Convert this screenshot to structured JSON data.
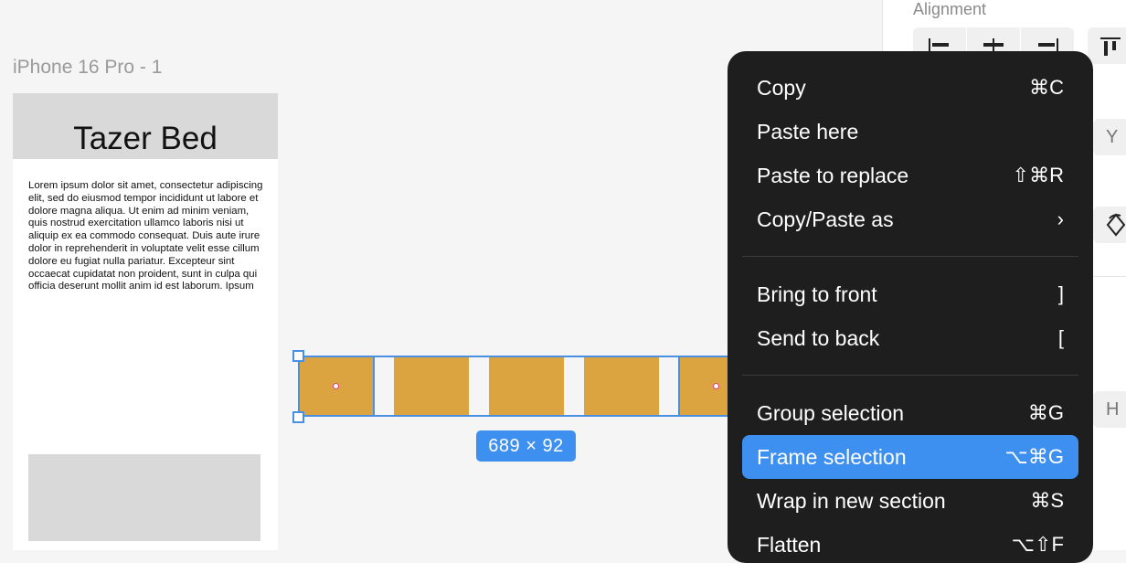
{
  "canvas": {
    "frame_label": "iPhone 16 Pro - 1",
    "frame_title": "Tazer Bed",
    "frame_body": "Lorem ipsum dolor sit amet, consectetur adipiscing elit, sed do eiusmod tempor incididunt ut labore et dolore magna aliqua. Ut enim ad minim veniam, quis nostrud exercitation ullamco laboris nisi ut aliquip ex ea commodo consequat. Duis aute irure dolor in reprehenderit in voluptate velit esse cillum dolore eu fugiat nulla pariatur. Excepteur sint occaecat cupidatat non proident, sunt in culpa qui officia deserunt mollit anim id est laborum. Ipsum",
    "selection_size": "689 × 92",
    "rect_color": "#dba440",
    "selection_color": "#4a90e2"
  },
  "panel": {
    "section_title": "Alignment",
    "field_y": "Y",
    "field_h": "H"
  },
  "menu": {
    "items": [
      {
        "label": "Copy",
        "shortcut": "⌘C"
      },
      {
        "label": "Paste here",
        "shortcut": ""
      },
      {
        "label": "Paste to replace",
        "shortcut": "⇧⌘R"
      },
      {
        "label": "Copy/Paste as",
        "shortcut": "›"
      },
      {
        "label": "Bring to front",
        "shortcut": "]"
      },
      {
        "label": "Send to back",
        "shortcut": "["
      },
      {
        "label": "Group selection",
        "shortcut": "⌘G"
      },
      {
        "label": "Frame selection",
        "shortcut": "⌥⌘G"
      },
      {
        "label": "Wrap in new section",
        "shortcut": "⌘S"
      },
      {
        "label": "Flatten",
        "shortcut": "⌥⇧F"
      }
    ],
    "active_color": "#3d8ff0",
    "background_color": "#1e1e1e"
  }
}
